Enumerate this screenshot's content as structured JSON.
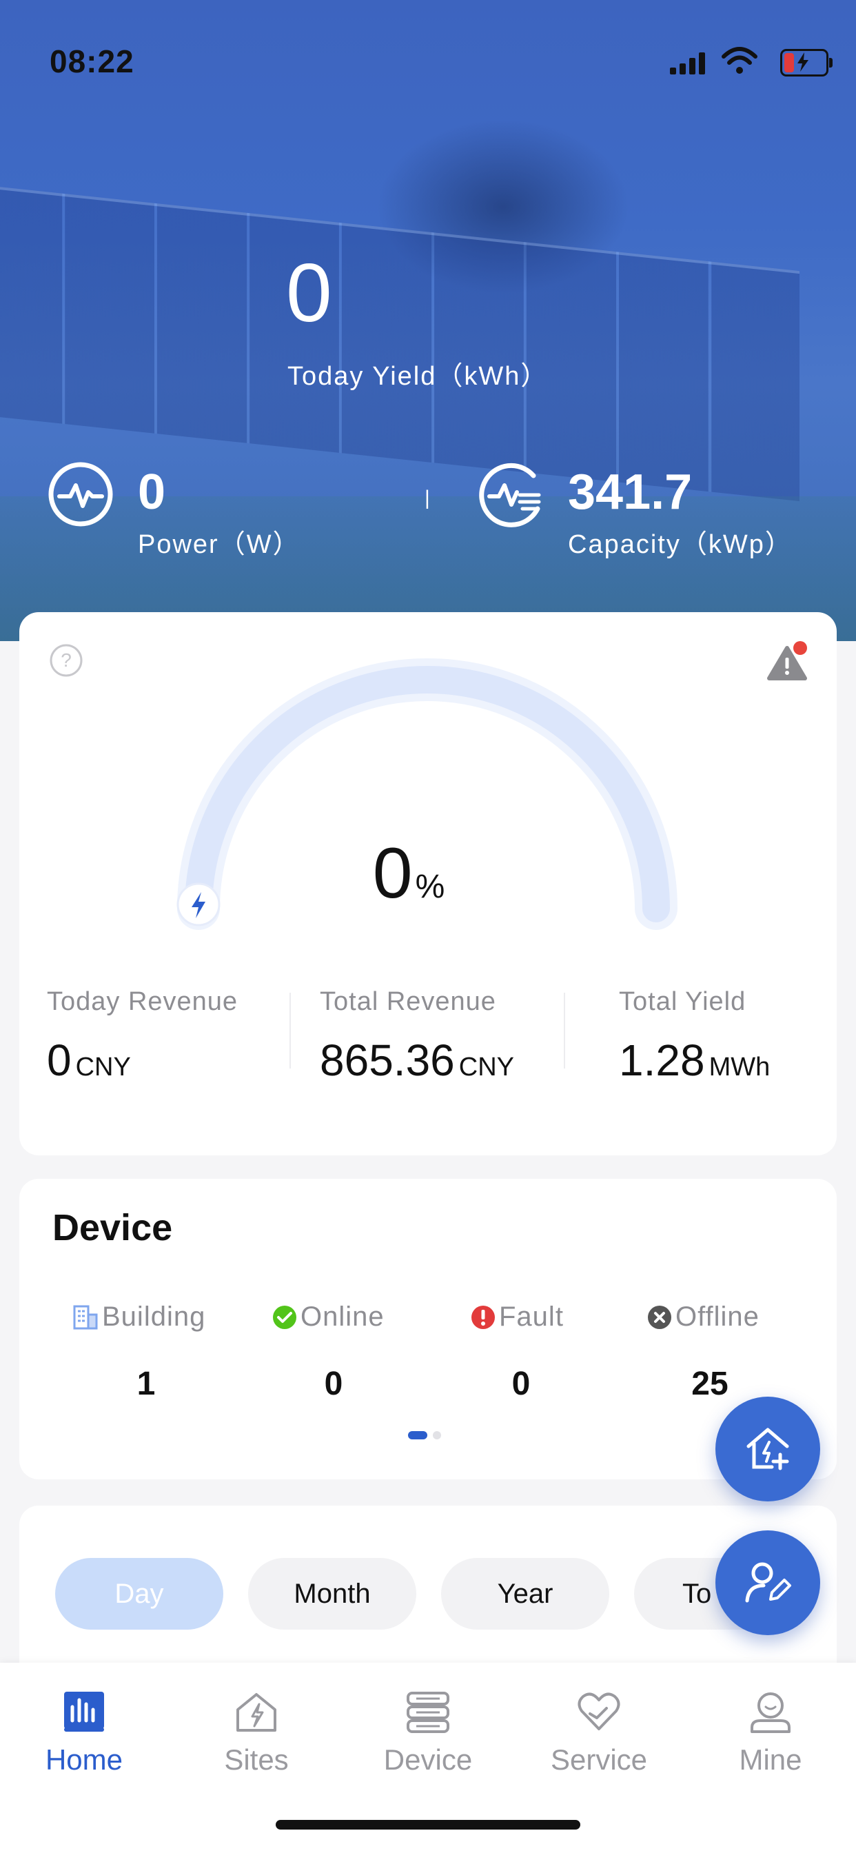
{
  "status_bar": {
    "time": "08:22"
  },
  "hero": {
    "today_yield_value": "0",
    "today_yield_label": "Today Yield（kWh）",
    "power_value": "0",
    "power_label": "Power（W）",
    "separator": "|",
    "capacity_value": "341.7",
    "capacity_label": "Capacity（kWp）"
  },
  "gauge": {
    "percent_value": "0",
    "percent_unit": "%",
    "fill_fraction": 0
  },
  "revenue": [
    {
      "label": "Today Revenue",
      "value": "0",
      "unit": "CNY"
    },
    {
      "label": "Total Revenue",
      "value": "865.36",
      "unit": "CNY"
    },
    {
      "label": "Total Yield",
      "value": "1.28",
      "unit": "MWh"
    }
  ],
  "device": {
    "title": "Device",
    "stats": [
      {
        "label": "Building",
        "value": "1",
        "icon": "building-icon"
      },
      {
        "label": "Online",
        "value": "0",
        "icon": "online-check-icon",
        "color": "#52c41a"
      },
      {
        "label": "Fault",
        "value": "0",
        "icon": "fault-alert-icon",
        "color": "#e23b3b"
      },
      {
        "label": "Offline",
        "value": "25",
        "icon": "offline-x-icon",
        "color": "#555555"
      }
    ]
  },
  "period_tabs": [
    "Day",
    "Month",
    "Year",
    "To"
  ],
  "tabbar": {
    "items": [
      {
        "label": "Home",
        "icon": "home-chart-icon",
        "active": true
      },
      {
        "label": "Sites",
        "icon": "sites-house-icon",
        "active": false
      },
      {
        "label": "Device",
        "icon": "device-server-icon",
        "active": false
      },
      {
        "label": "Service",
        "icon": "service-heart-icon",
        "active": false
      },
      {
        "label": "Mine",
        "icon": "mine-user-icon",
        "active": false
      }
    ]
  },
  "colors": {
    "accent": "#2b5dcc",
    "fab": "#3a6bd2",
    "gauge_track": "#dce6fb"
  }
}
